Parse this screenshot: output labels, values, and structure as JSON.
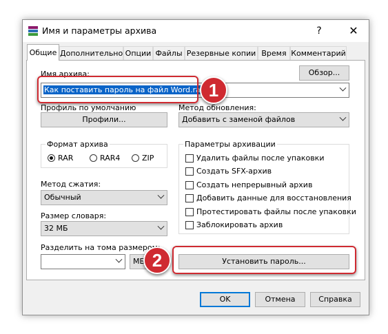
{
  "window": {
    "title": "Имя и параметры архива",
    "help": "?",
    "close": "✕"
  },
  "tabs": [
    "Общие",
    "Дополнительно",
    "Опции",
    "Файлы",
    "Резервные копии",
    "Время",
    "Комментарий"
  ],
  "general": {
    "archive_name_label": "Имя архива:",
    "archive_name_value": "Как поставить пароль на файл Word.rar",
    "browse_button": "Обзор...",
    "default_profile_label": "Профиль по умолчанию",
    "profiles_button": "Профили...",
    "update_method_label": "Метод обновления:",
    "update_method_value": "Добавить с заменой файлов",
    "archive_format_label": "Формат архива",
    "formats": [
      "RAR",
      "RAR4",
      "ZIP"
    ],
    "selected_format": "RAR",
    "compression_label": "Метод сжатия:",
    "compression_value": "Обычный",
    "dictionary_label": "Размер словаря:",
    "dictionary_value": "32 МБ",
    "split_label": "Разделить на тома размером:",
    "split_value": "",
    "split_unit": "МБ",
    "options_label": "Параметры архивации",
    "options": [
      "Удалить файлы после упаковки",
      "Создать SFX-архив",
      "Создать непрерывный архив",
      "Добавить данные для восстановления",
      "Протестировать файлы после упаковки",
      "Заблокировать архив"
    ],
    "set_password_button": "Установить пароль..."
  },
  "footer": {
    "ok": "OK",
    "cancel": "Отмена",
    "help": "Справка"
  },
  "annotations": {
    "badge1": "1",
    "badge2": "2",
    "highlight_color": "#cf2a31"
  }
}
